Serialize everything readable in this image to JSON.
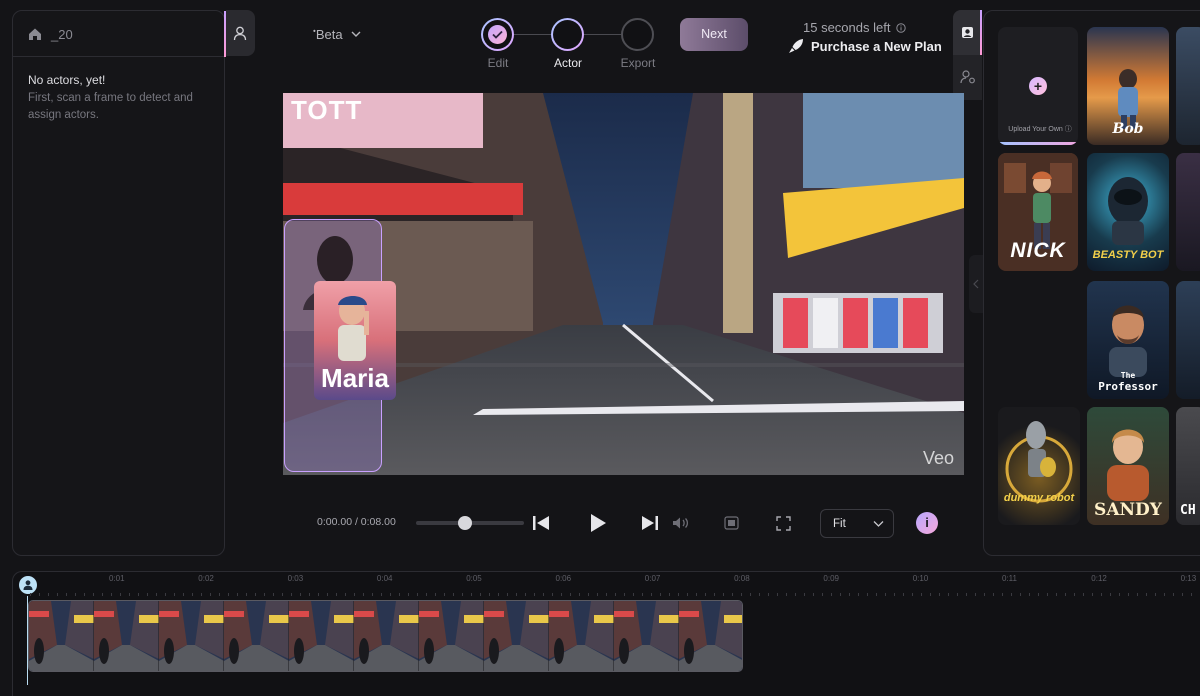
{
  "project": {
    "name": "_20"
  },
  "actors_panel": {
    "empty_title": "No actors, yet!",
    "empty_description": "First, scan a frame to detect and assign actors."
  },
  "model": {
    "selected": "Beta"
  },
  "stepper": {
    "steps": [
      {
        "label": "Edit",
        "state": "done"
      },
      {
        "label": "Actor",
        "state": "active"
      },
      {
        "label": "Export",
        "state": "pending"
      }
    ],
    "next_label": "Next"
  },
  "trial": {
    "time_left": "15 seconds left",
    "purchase_label": "Purchase a New Plan"
  },
  "library": {
    "upload_label": "Upload Your Own",
    "cards": [
      {
        "name": "Bob"
      },
      {
        "name": "NICK"
      },
      {
        "name": "BEASTY BOT"
      },
      {
        "name": "The Professor"
      },
      {
        "name": "dummy robot"
      },
      {
        "name": "SANDY"
      },
      {
        "name": "CH"
      }
    ]
  },
  "video": {
    "overlay_actor_name": "Maria",
    "watermark": "Veo",
    "sign_text": "TOTT"
  },
  "player": {
    "timecode": "0:00.00 / 0:08.00",
    "fit_label": "Fit",
    "progress": 0.45
  },
  "timeline": {
    "ticks": [
      "0:01",
      "0:02",
      "0:03",
      "0:04",
      "0:05",
      "0:06",
      "0:07",
      "0:08",
      "0:09",
      "0:10",
      "0:11",
      "0:12",
      "0:13"
    ]
  },
  "colors": {
    "accent_gradient_start": "#a8c4ff",
    "accent_gradient_end": "#f0a6e0",
    "background": "#141417"
  }
}
